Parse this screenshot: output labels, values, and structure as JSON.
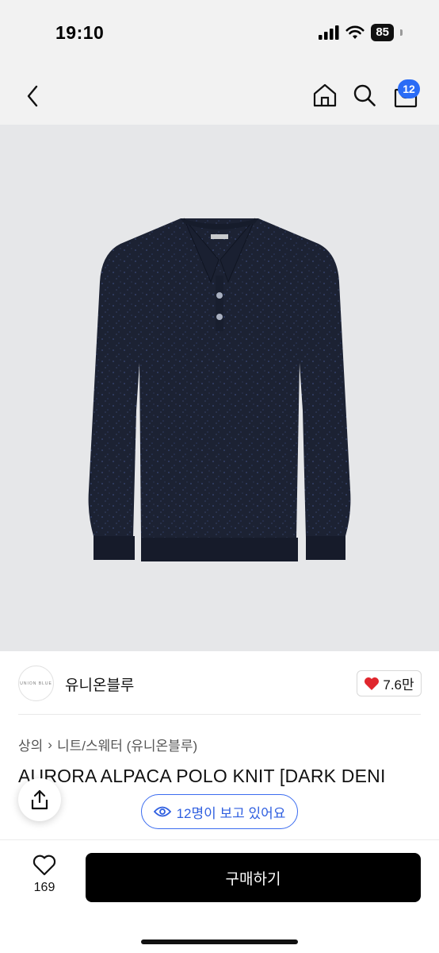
{
  "status_bar": {
    "time": "19:10",
    "battery": "85",
    "icons": [
      "signal-icon",
      "wifi-icon",
      "battery-icon"
    ]
  },
  "nav": {
    "back_icon": "chevron-left-icon",
    "home_icon": "home-icon",
    "search_icon": "search-icon",
    "bag_icon": "shopping-bag-icon",
    "cart_count": "12"
  },
  "product_image": {
    "subject": "navy alpaca polo knit sweater",
    "background_color": "#e6e7e9",
    "garment_color": "#1c2233"
  },
  "brand": {
    "logo_text": "UNION BLUE",
    "name": "유니온블루",
    "likes": "7.6만",
    "like_icon": "heart-filled-icon",
    "like_color": "#e0262d"
  },
  "breadcrumb": {
    "category": "상의",
    "separator": "›",
    "subcategory": "니트/스웨터 (유니온블루)"
  },
  "product": {
    "title": "AURORA ALPACA POLO KNIT [DARK DENI"
  },
  "viewers": {
    "text": "12명이 보고 있어요",
    "icon": "eye-icon",
    "accent": "#3c6df0"
  },
  "share": {
    "icon": "share-icon"
  },
  "bottom_bar": {
    "wish_icon": "heart-outline-icon",
    "wish_count": "169",
    "buy_label": "구매하기"
  }
}
